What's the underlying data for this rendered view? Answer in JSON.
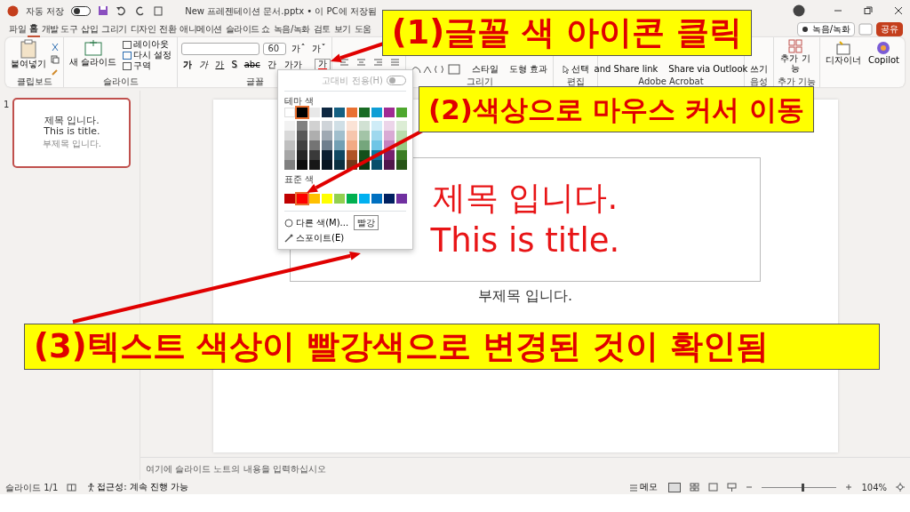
{
  "title_bar": {
    "autosave_label": "자동 저장",
    "autosave_on": false,
    "document_title": "New 프레젠테이션 문서.pptx • 이 PC에 저장됨"
  },
  "menu_tabs": [
    {
      "label": "파일",
      "selected": false
    },
    {
      "label": "홈",
      "selected": true
    },
    {
      "label": "개발 도구",
      "selected": false
    },
    {
      "label": "삽입",
      "selected": false
    },
    {
      "label": "그리기",
      "selected": false
    },
    {
      "label": "디자인",
      "selected": false
    },
    {
      "label": "전환",
      "selected": false
    },
    {
      "label": "애니메이션",
      "selected": false
    },
    {
      "label": "슬라이드 쇼",
      "selected": false
    },
    {
      "label": "녹음/녹화",
      "selected": false
    },
    {
      "label": "검토",
      "selected": false
    },
    {
      "label": "보기",
      "selected": false
    },
    {
      "label": "도움",
      "selected": false
    }
  ],
  "header_buttons": {
    "record": "녹음/녹화",
    "share": "공유"
  },
  "ribbon": {
    "clipboard": {
      "paste": "붙여넣기",
      "label": "클립보드"
    },
    "slides": {
      "new_slide": "새 슬라이드",
      "layout": "레이아웃",
      "reset": "다시 설정",
      "section": "구역",
      "label": "슬라이드"
    },
    "font": {
      "size": "60",
      "grow": "가ˆ",
      "shrink": "가ˇ",
      "label": "글꼴",
      "font_color": {
        "label": "가",
        "color": "#ff0000"
      },
      "formats": [
        {
          "kind": "bold",
          "label": "가"
        },
        {
          "kind": "italic",
          "label": "가"
        },
        {
          "kind": "underline",
          "label": "가"
        },
        {
          "kind": "shadow",
          "label": "S"
        },
        {
          "kind": "strike",
          "label": "abc"
        },
        {
          "kind": "spacing",
          "label": "간"
        },
        {
          "kind": "case",
          "label": "가가"
        }
      ]
    },
    "drawing": {
      "style": "스타일",
      "effects": "도형 효과",
      "label": "그리기"
    },
    "editing": {
      "select": "선택",
      "label": "편집"
    },
    "acrobat": {
      "share_link": "and Share link",
      "share_outlook": "Share via Outlook",
      "label": "Adobe Acrobat"
    },
    "voice": {
      "dictate": "쓰기",
      "label": "음성"
    },
    "addins": {
      "button": "추가 기능",
      "label": "추가 기능"
    },
    "designer": "디자이너",
    "copilot": "Copilot"
  },
  "slides_panel": {
    "number": "1",
    "selected": true,
    "title": "제목 입니다.",
    "title_en": "This is title.",
    "subtitle": "부제목 입니다."
  },
  "slide": {
    "title": "제목 입니다.",
    "title_en": "This is title.",
    "subtitle": "부제목 입니다.",
    "title_selected": true
  },
  "notes_placeholder": "여기에 슬라이드 노트의 내용을 입력하십시오",
  "status_bar": {
    "slide": "슬라이드 1/1",
    "accessibility": "접근성: 계속 진행 가능",
    "notes": "메모",
    "zoom": "104%",
    "zoom_slider": {
      "level": 0.55
    }
  },
  "color_menu": {
    "high_contrast": "고대비 전용(H)",
    "high_contrast_toggle": {
      "on": false,
      "disabled": true
    },
    "theme_label": "테마 색",
    "theme_colors": [
      {
        "color": "#ffffff",
        "selected": false
      },
      {
        "color": "#000000",
        "selected": true
      },
      {
        "color": "#e8e8e8",
        "selected": false
      },
      {
        "color": "#0e2841",
        "selected": false
      },
      {
        "color": "#156082",
        "selected": false
      },
      {
        "color": "#e97132",
        "selected": false
      },
      {
        "color": "#196b24",
        "selected": false
      },
      {
        "color": "#0f9ed5",
        "selected": false
      },
      {
        "color": "#a02b93",
        "selected": false
      },
      {
        "color": "#4ea72e",
        "selected": false
      }
    ],
    "standard_label": "표준 색",
    "standard_colors": [
      {
        "color": "#c00000",
        "selected": false
      },
      {
        "color": "#ff0000",
        "selected": true
      },
      {
        "color": "#ffc000",
        "selected": false
      },
      {
        "color": "#ffff00",
        "selected": false
      },
      {
        "color": "#92d050",
        "selected": false
      },
      {
        "color": "#00b050",
        "selected": false
      },
      {
        "color": "#00b0f0",
        "selected": false
      },
      {
        "color": "#0070c0",
        "selected": false
      },
      {
        "color": "#002060",
        "selected": false
      },
      {
        "color": "#7030a0",
        "selected": false
      }
    ],
    "more_colors": "다른 색(M)...",
    "eyedropper": "스포이트(E)",
    "tooltip": "빨강"
  },
  "callouts": [
    {
      "text": "(1)글꼴 색 아이콘 클릭"
    },
    {
      "text": "(2)색상으로 마우스 커서 이동"
    },
    {
      "text": "(3)텍스트 색상이 빨강색으로 변경된 것이 확인됨"
    }
  ]
}
